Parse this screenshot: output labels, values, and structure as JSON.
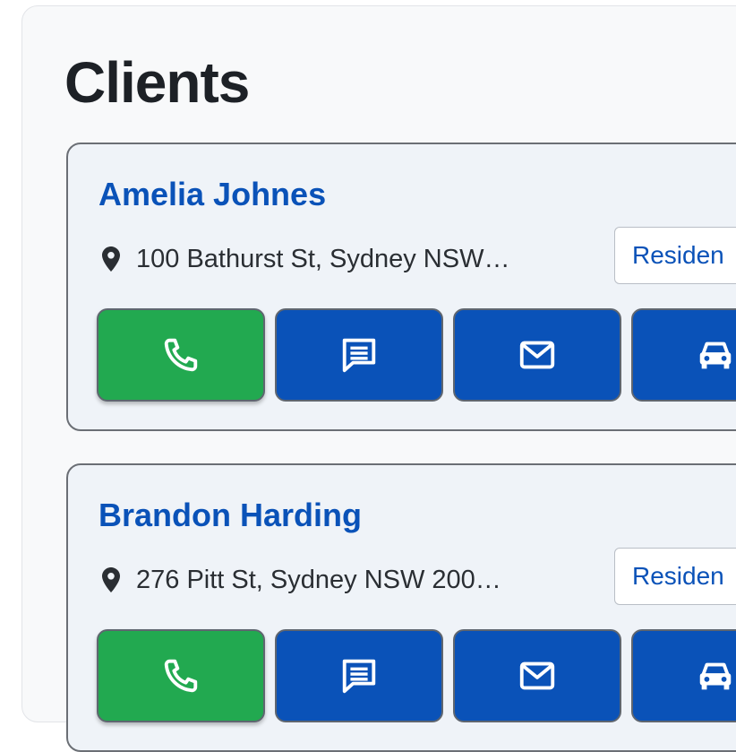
{
  "page": {
    "title": "Clients"
  },
  "clients": [
    {
      "name": "Amelia Johnes",
      "address": "100 Bathurst St, Sydney NSW…",
      "type": "Residen",
      "actions": [
        "phone-icon",
        "message-icon",
        "email-icon",
        "car-icon"
      ]
    },
    {
      "name": "Brandon Harding",
      "address": "276 Pitt St, Sydney NSW 200…",
      "type": "Residen",
      "actions": [
        "phone-icon",
        "message-icon",
        "email-icon",
        "car-icon"
      ]
    }
  ],
  "colors": {
    "accent": "#0a52b8",
    "call": "#22a950",
    "card_bg": "#eff3f8"
  }
}
